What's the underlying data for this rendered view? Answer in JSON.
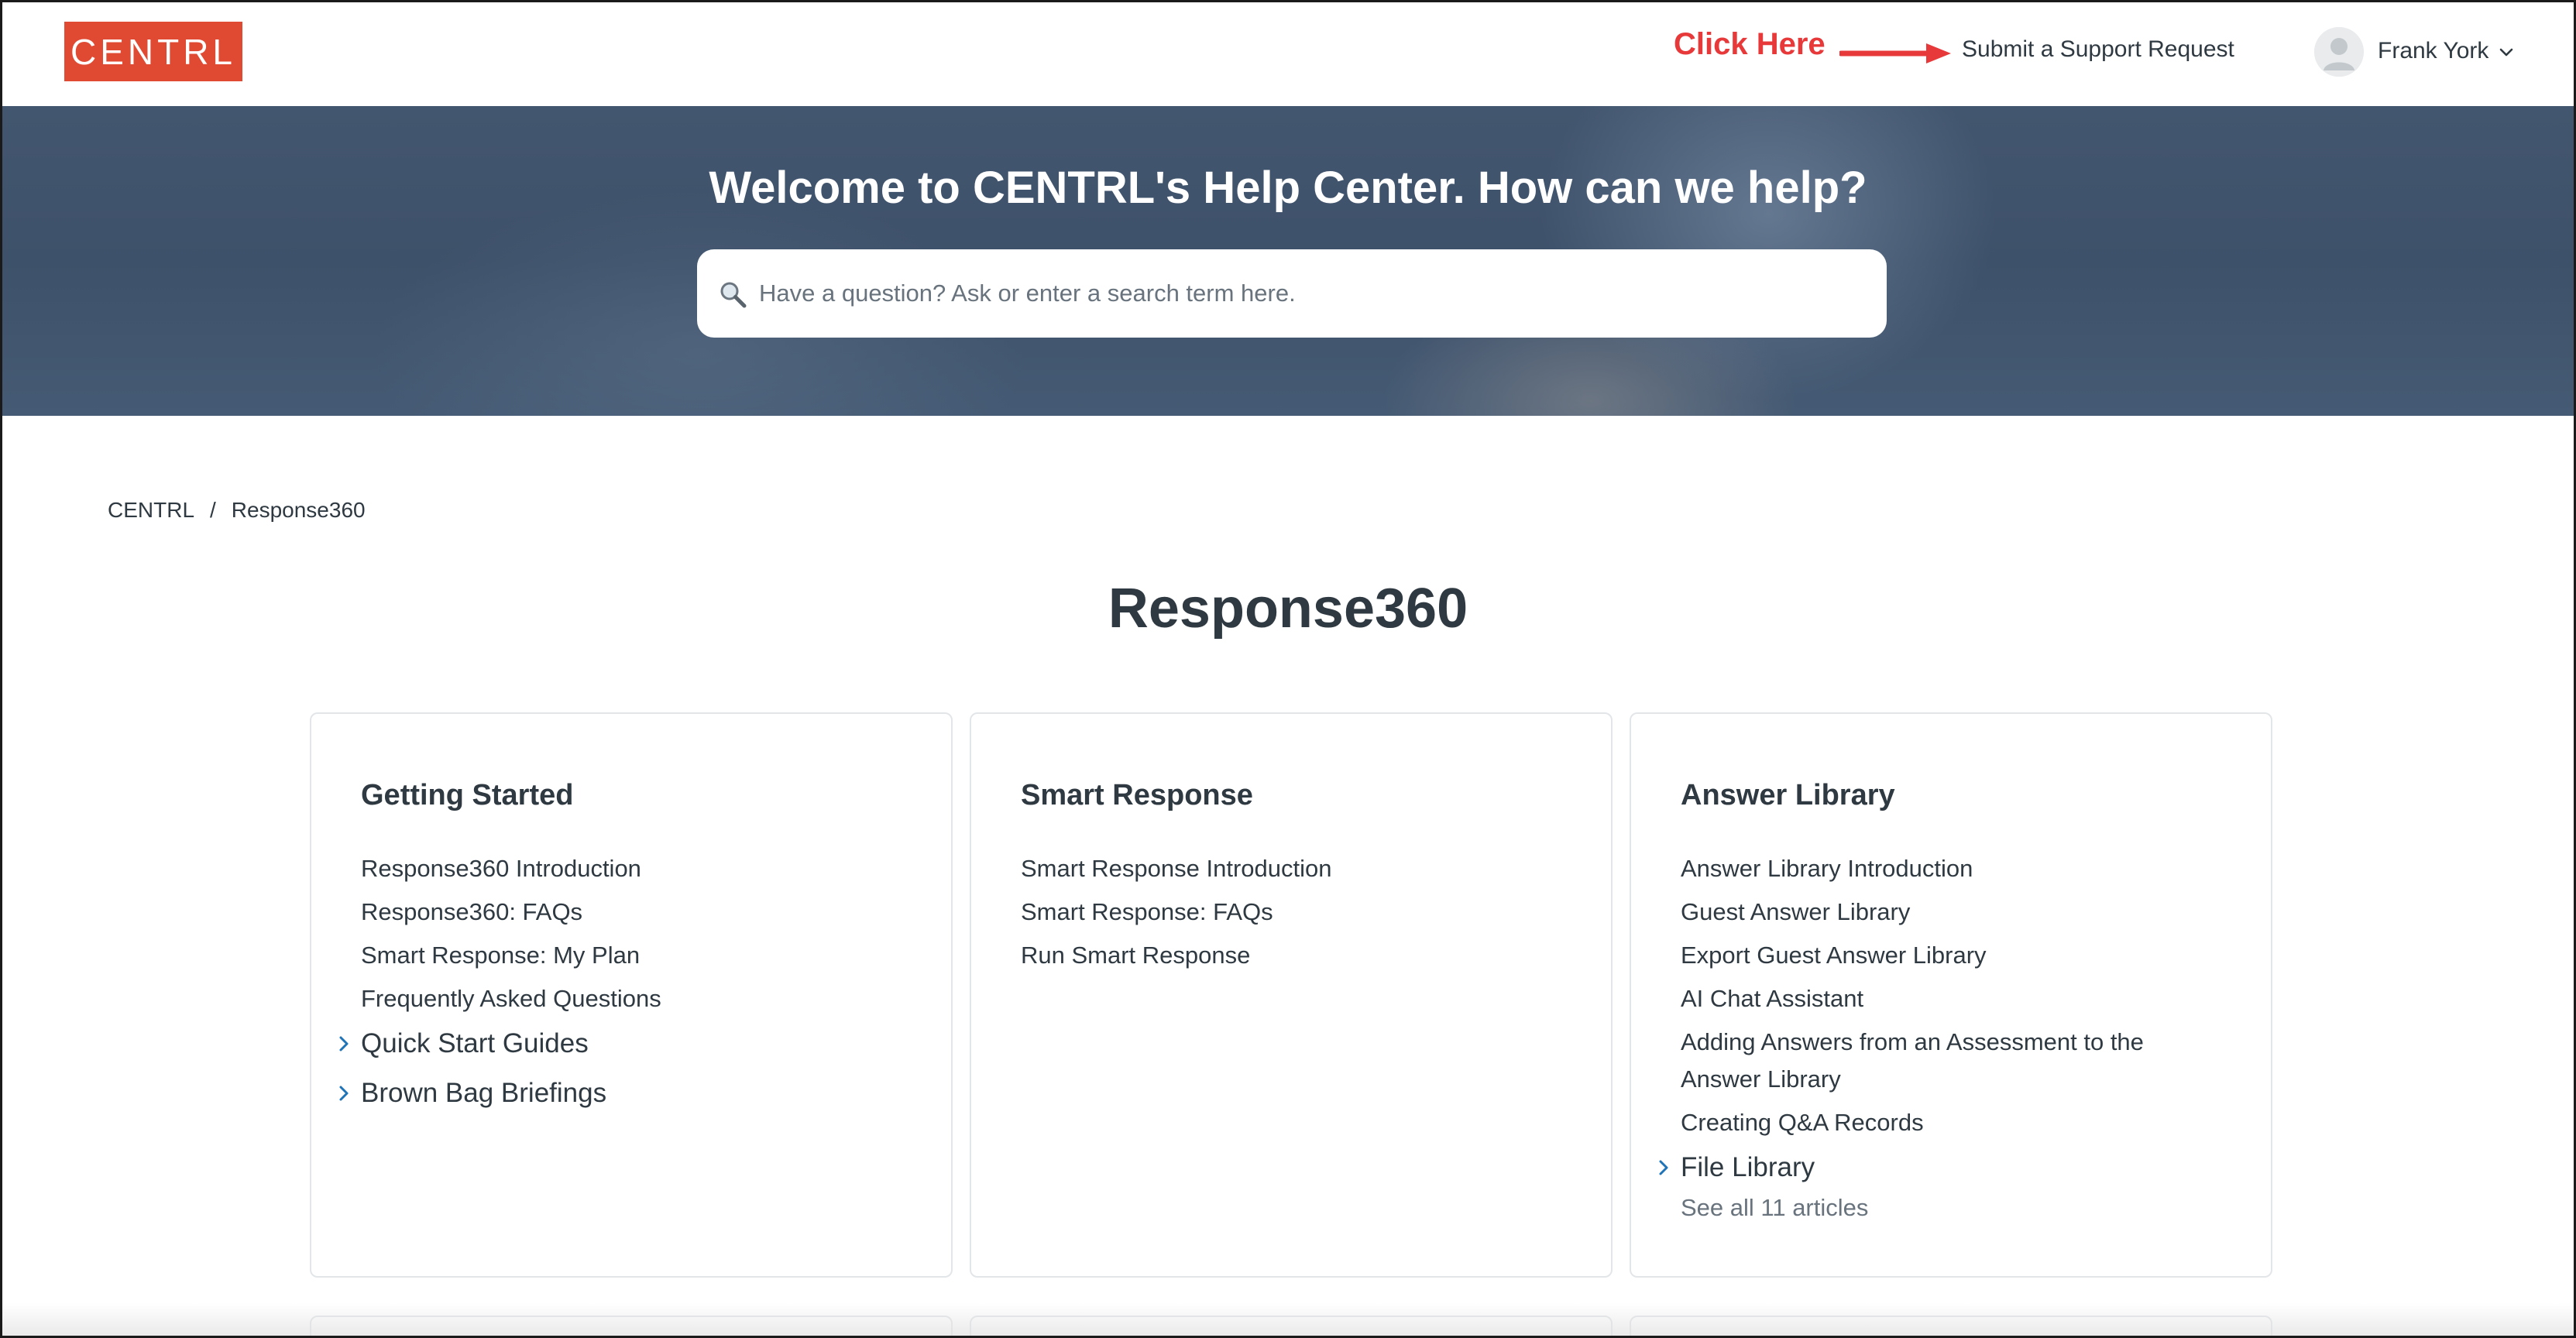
{
  "header": {
    "logo_text": "CENTRL",
    "annotation": "Click Here",
    "submit_link": "Submit a Support Request",
    "user_name": "Frank York",
    "accent_color": "#e04a32",
    "annotation_color": "#e8393a"
  },
  "hero": {
    "title": "Welcome to CENTRL's Help Center. How can we help?",
    "search_placeholder": "Have a question? Ask or enter a search term here."
  },
  "breadcrumb": {
    "items": [
      "CENTRL",
      "Response360"
    ],
    "separator": "/"
  },
  "page_title": "Response360",
  "cards": [
    {
      "title": "Getting Started",
      "articles": [
        "Response360 Introduction",
        "Response360: FAQs",
        "Smart Response: My Plan",
        "Frequently Asked Questions"
      ],
      "sections": [
        "Quick Start Guides",
        "Brown Bag Briefings"
      ]
    },
    {
      "title": "Smart Response",
      "articles": [
        "Smart Response Introduction",
        "Smart Response: FAQs",
        "Run Smart Response"
      ],
      "sections": []
    },
    {
      "title": "Answer Library",
      "articles": [
        "Answer Library Introduction",
        "Guest Answer Library",
        "Export Guest Answer Library",
        "AI Chat Assistant",
        "Adding Answers from an Assessment to the Answer Library",
        "Creating Q&A Records"
      ],
      "sections": [
        "File Library"
      ],
      "see_all": "See all 11 articles"
    }
  ],
  "icons": {
    "search": "search-icon",
    "avatar": "user-avatar-icon",
    "dropdown": "chevron-down-icon",
    "section": "chevron-right-icon",
    "annotation": "arrow-right-icon"
  }
}
